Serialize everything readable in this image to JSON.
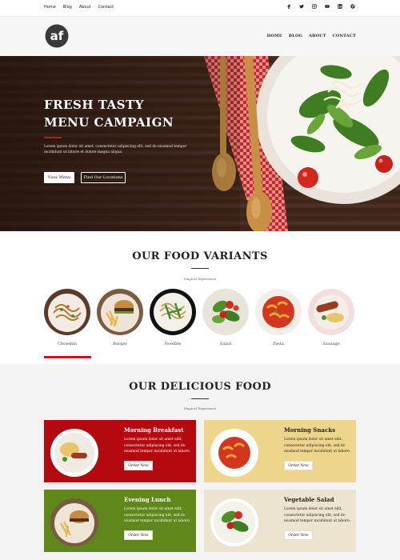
{
  "top_links": [
    "Home",
    "Blog",
    "About",
    "Contact"
  ],
  "social_icons": [
    "facebook-icon",
    "twitter-icon",
    "instagram-icon",
    "youtube-icon",
    "linkedin-icon",
    "pinterest-icon"
  ],
  "logo_text": "af",
  "nav": [
    "HOME",
    "BLOG",
    "ABOUT",
    "CONTACT"
  ],
  "hero": {
    "title_line1": "FRESH TASTY",
    "title_line2": "MENU CAMPAIGN",
    "text": "Lorem ipsum dolor sit amet, consectetur adipiscing elit, sed do eiusmod tempor incididunt ut labore et dolore magna aliqua.",
    "btn_primary": "View Menu",
    "btn_secondary": "Find Our Locations"
  },
  "variants_section": {
    "title": "OUR FOOD VARIANTS",
    "subtitle": "Magical Experience",
    "items": [
      "Chowmin",
      "Burger",
      "Noodles",
      "Salad",
      "Pasta",
      "Sausage"
    ],
    "active_index": 0
  },
  "delicious_section": {
    "title": "OUR DELICIOUS FOOD",
    "subtitle": "Magical Experience",
    "cards": [
      {
        "title": "Morning Breakfast",
        "text": "Lorem ipsum dolor sit amet edit, consectetur adipiscing elit, sed do eiusmod tempor incididunt ut labore.",
        "button": "Order Now",
        "bg": "#b4090e"
      },
      {
        "title": "Morning Snacks",
        "text": "Lorem ipsum dolor sit amet edit, consectetur adipiscing elit, sed do eiusmod tempor incididunt ut labore.",
        "button": "Order Now",
        "bg": "#edd58c"
      },
      {
        "title": "Evening Lunch",
        "text": "Lorem ipsum dolor sit amet edit, consectetur adipiscing elit, sed do eiusmod tempor incididunt ut labore.",
        "button": "Order Now",
        "bg": "#5f8719"
      },
      {
        "title": "Vegetable Salad",
        "text": "Lorem ipsum dolor sit amet edit, consectetur adipiscing elit, sed do eiusmod tempor incididunt ut labore.",
        "button": "Order Now",
        "bg": "#ece4cf"
      }
    ]
  },
  "colors": {
    "accent": "#c4161c",
    "hero_wood": "#3f261b"
  }
}
